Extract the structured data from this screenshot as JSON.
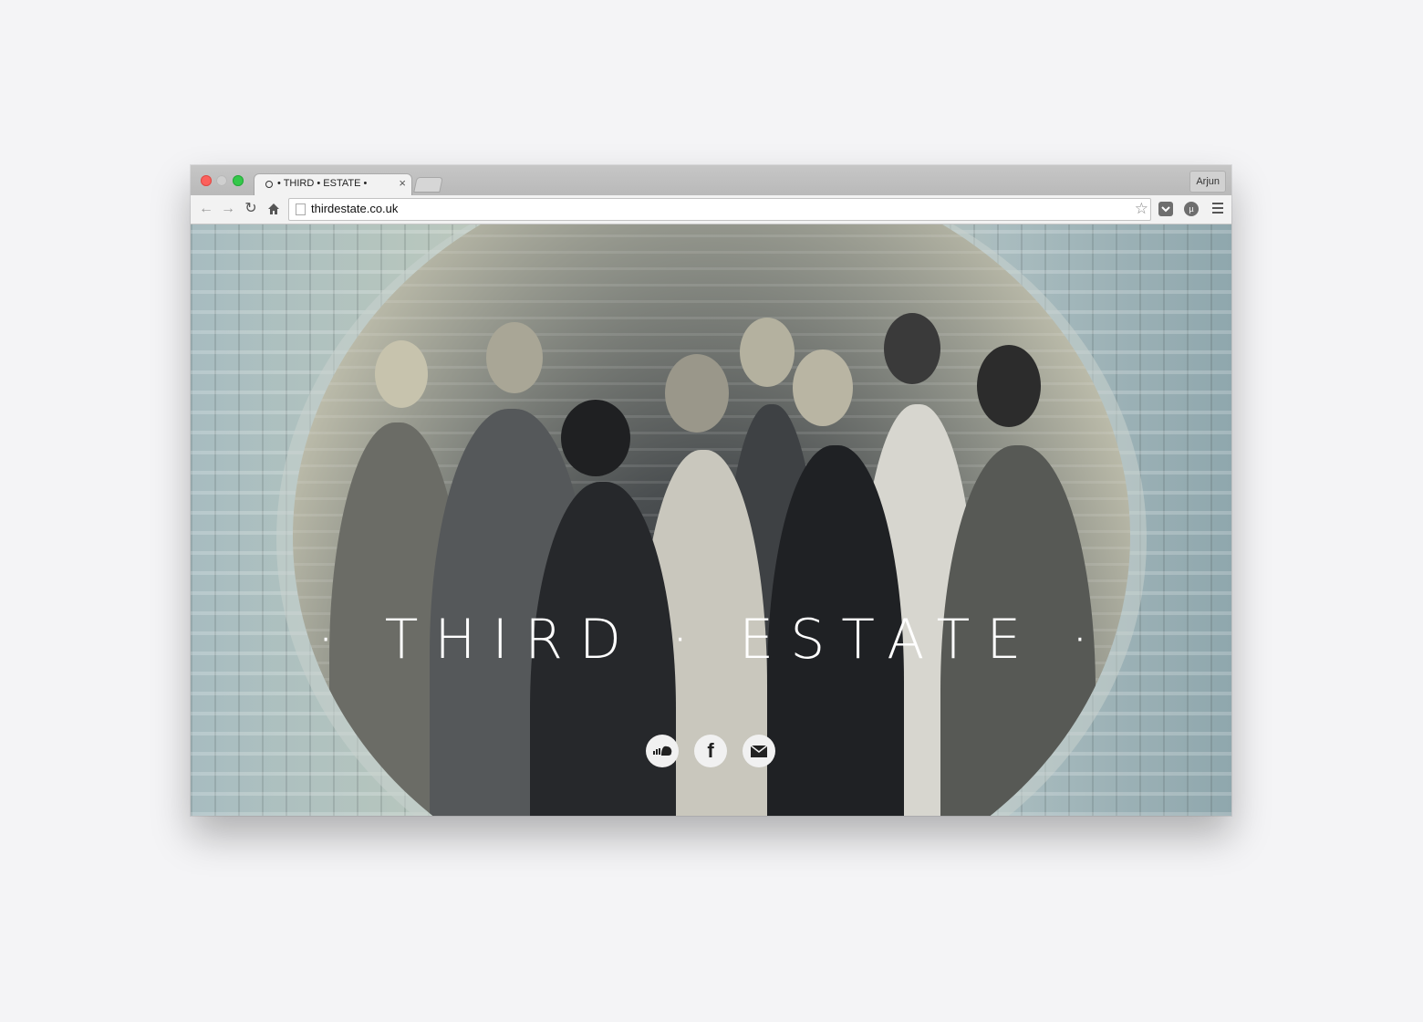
{
  "browser": {
    "tab_title": "• THIRD • ESTATE •",
    "url": "thirdestate.co.uk",
    "profile_name": "Arjun"
  },
  "hero": {
    "title": "· THIRD · ESTATE ·"
  },
  "social": [
    {
      "icon": "soundcloud-icon"
    },
    {
      "icon": "facebook-icon",
      "glyph": "f"
    },
    {
      "icon": "mail-icon"
    }
  ],
  "colors": {
    "page_background": "#f4f4f6",
    "traffic_red": "#fc605c",
    "traffic_green": "#34c84a"
  }
}
